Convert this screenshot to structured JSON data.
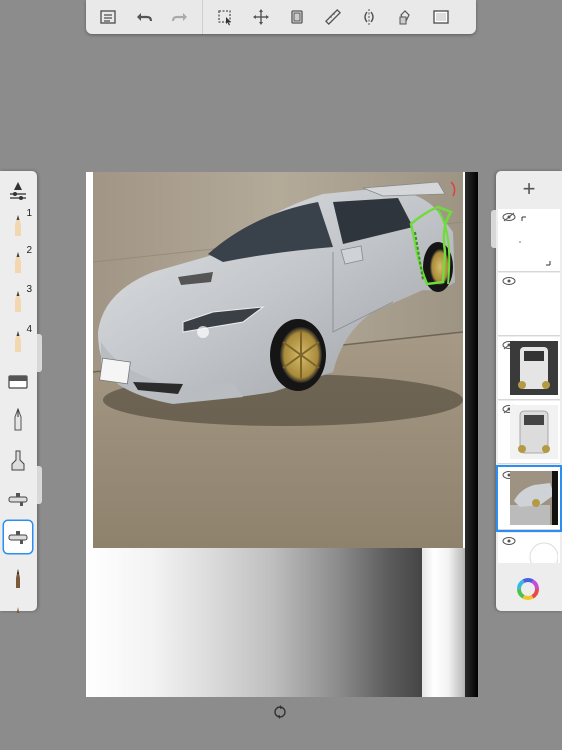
{
  "toolbar": {
    "left_group": [
      "list-icon",
      "undo-icon",
      "redo-icon"
    ],
    "right_group": [
      "selection-icon",
      "transform-icon",
      "stack-icon",
      "ruler-icon",
      "symmetry-icon",
      "fill-icon",
      "fullscreen-icon"
    ]
  },
  "brush_palette": {
    "brushes": [
      {
        "name": "brush-settings-icon",
        "num": ""
      },
      {
        "name": "pencil-1",
        "num": "1"
      },
      {
        "name": "pencil-2",
        "num": "2"
      },
      {
        "name": "pencil-3",
        "num": "3"
      },
      {
        "name": "pencil-4",
        "num": "4"
      },
      {
        "name": "eraser-icon",
        "num": ""
      },
      {
        "name": "pen-icon",
        "num": ""
      },
      {
        "name": "marker-icon",
        "num": ""
      },
      {
        "name": "airbrush-icon",
        "num": ""
      },
      {
        "name": "airbrush-selected-icon",
        "num": ""
      },
      {
        "name": "paintbrush-icon",
        "num": ""
      }
    ],
    "active_index": 9
  },
  "layers": {
    "add_label": "+",
    "items": [
      {
        "name": "layer-sketch",
        "visible": "hidden"
      },
      {
        "name": "layer-blank",
        "visible": "visible"
      },
      {
        "name": "layer-rear-view-1",
        "visible": "hidden"
      },
      {
        "name": "layer-rear-view-2",
        "visible": "hidden"
      },
      {
        "name": "layer-car-photo",
        "visible": "visible"
      },
      {
        "name": "layer-background",
        "visible": "visible"
      }
    ],
    "active_index": 4
  },
  "colors": {
    "accent": "#2a8ff0",
    "ui_bg": "#8c8c8c",
    "panel": "#ededed",
    "car_body": "#c7c9cc",
    "wheel_gold": "#b59a46",
    "sketch_green": "#6fdc3c"
  }
}
